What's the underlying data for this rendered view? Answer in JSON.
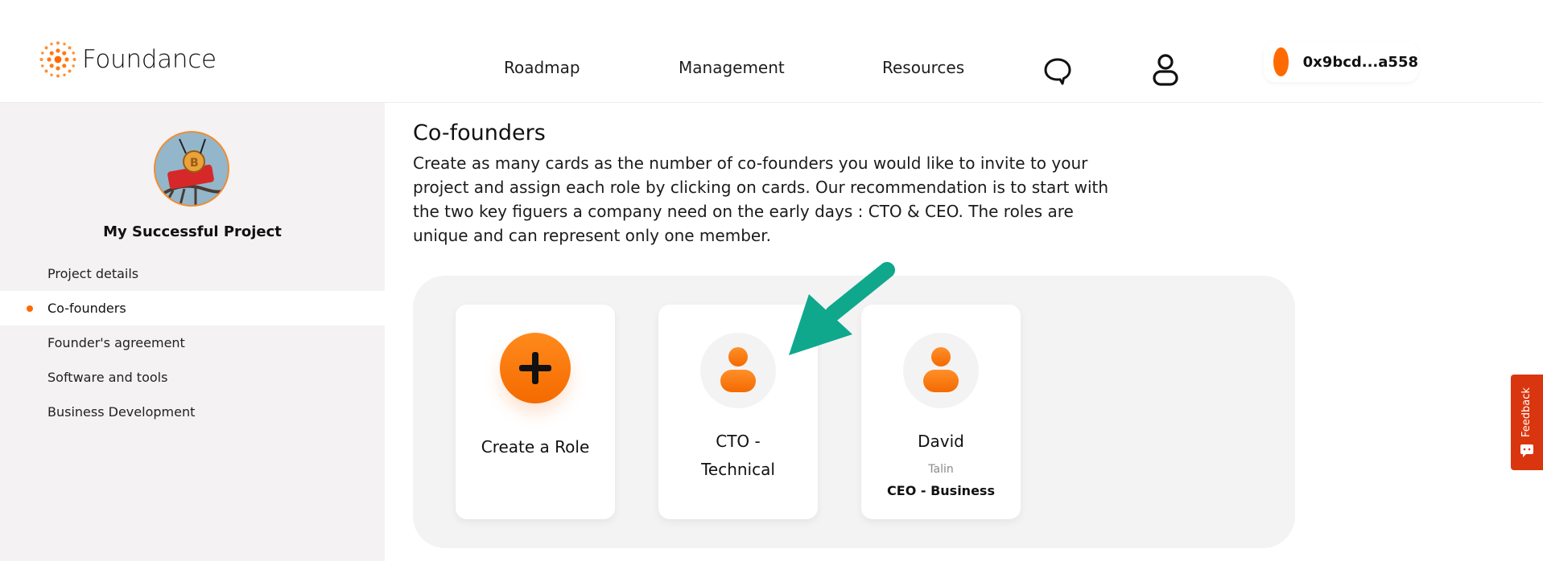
{
  "header": {
    "logo_text": "Foundance",
    "nav": [
      "Roadmap",
      "Management",
      "Resources"
    ],
    "icons": [
      "chat-bubble-icon",
      "user-icon"
    ],
    "wallet_address": "0x9bcd...a558",
    "accent_color": "#ff6a00"
  },
  "sidebar": {
    "project_name": "My Successful Project",
    "items": [
      {
        "label": "Project details",
        "active": false
      },
      {
        "label": "Co-founders",
        "active": true
      },
      {
        "label": "Founder's agreement",
        "active": false
      },
      {
        "label": "Software and tools",
        "active": false
      },
      {
        "label": "Business Development",
        "active": false
      }
    ]
  },
  "main": {
    "title": "Co-founders",
    "description": "Create as many cards as the number of co-founders you would like to invite to your project and assign each role by clicking on cards. Our recommendation is to start with the two key figuers a company need on the early days : CTO & CEO. The roles are unique and can represent only one member.",
    "cards": [
      {
        "label": "Create a Role",
        "icon": "plus-icon"
      },
      {
        "label_line1": "CTO -",
        "label_line2": "Technical",
        "icon": "person-icon"
      },
      {
        "name": "David",
        "subtitle": "Talin",
        "role": "CEO - Business",
        "icon": "person-icon"
      }
    ]
  },
  "feedback": {
    "label": "Feedback",
    "color": "#d9360f"
  }
}
